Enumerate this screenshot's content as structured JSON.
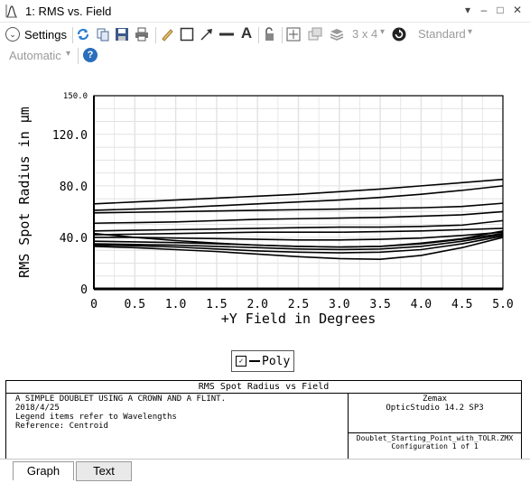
{
  "window": {
    "title": "1: RMS vs. Field",
    "controls": [
      "▾",
      "–",
      "□",
      "✕"
    ]
  },
  "toolbar": {
    "settings_label": "Settings",
    "layout_label": "3 x 4",
    "layout_arrow": "▾",
    "standard_label": "Standard",
    "standard_arrow": "▾",
    "automatic_label": "Automatic",
    "automatic_arrow": "▾",
    "text_tool_glyph": "A",
    "help_glyph": "?"
  },
  "chart_data": {
    "type": "line",
    "ylabel": "RMS Spot Radius in µm",
    "xlabel": "+Y Field in Degrees",
    "xlim": [
      0,
      5
    ],
    "ylim": [
      0,
      150
    ],
    "x_ticks": [
      "0",
      "0.5",
      "1.0",
      "1.5",
      "2.0",
      "2.5",
      "3.0",
      "3.5",
      "4.0",
      "4.5",
      "5.0"
    ],
    "y_ticks": [
      "0",
      "40.0",
      "80.0",
      "120.0",
      "150.0"
    ],
    "grid": true,
    "legend": [
      "Poly"
    ],
    "series_color": "#000000",
    "x": [
      0,
      0.5,
      1,
      1.5,
      2,
      2.5,
      3,
      3.5,
      4,
      4.5,
      5
    ],
    "series": [
      {
        "values": [
          66,
          67.5,
          69,
          70.5,
          72,
          73.5,
          75.5,
          77.5,
          80,
          82.5,
          85
        ]
      },
      {
        "values": [
          61,
          62,
          63,
          64.5,
          66,
          67.5,
          69,
          71,
          73.5,
          76.5,
          80
        ]
      },
      {
        "values": [
          59,
          59.5,
          60,
          60.5,
          61,
          61.5,
          62,
          62.5,
          63,
          64,
          66.5
        ]
      },
      {
        "values": [
          51,
          51.5,
          52,
          53,
          54,
          54.5,
          55,
          55.5,
          56.5,
          57.5,
          60
        ]
      },
      {
        "values": [
          45,
          45.5,
          46,
          46.5,
          47,
          47.5,
          48,
          48,
          48.5,
          49.5,
          53
        ]
      },
      {
        "values": [
          42,
          42.5,
          43,
          43.5,
          44,
          44,
          44,
          44.5,
          45,
          46,
          47
        ]
      },
      {
        "values": [
          40,
          40,
          39.5,
          39,
          38.5,
          38,
          38,
          38.5,
          39.5,
          41.5,
          44
        ]
      },
      {
        "values": [
          37,
          36.5,
          36,
          35,
          34,
          33,
          32.5,
          33,
          35,
          38.5,
          43
        ]
      },
      {
        "values": [
          35,
          34.5,
          34,
          33,
          32,
          31,
          30.5,
          31,
          33,
          37,
          42
        ]
      },
      {
        "values": [
          34,
          33.5,
          32.5,
          31,
          29.5,
          28.5,
          28,
          28.5,
          30.5,
          35,
          41
        ]
      },
      {
        "values": [
          33,
          32,
          30.5,
          29,
          27,
          25,
          23.5,
          23,
          26,
          32,
          40
        ]
      },
      {
        "values": [
          43,
          40,
          37.5,
          35.5,
          34,
          33,
          32.5,
          33,
          35.5,
          39,
          45
        ]
      }
    ]
  },
  "info": {
    "title": "RMS Spot Radius vs Field",
    "line1": "A SIMPLE DOUBLET USING A CROWN AND A FLINT.",
    "line2": "2018/4/25",
    "line3": "Legend items refer to Wavelengths",
    "line4": "Reference: Centroid",
    "company": "Zemax",
    "version": "OpticStudio 14.2 SP3",
    "file": "Doublet_Starting_Point_with_TOLR.ZMX",
    "config": "Configuration 1 of 1"
  },
  "tabs": [
    "Graph",
    "Text"
  ]
}
